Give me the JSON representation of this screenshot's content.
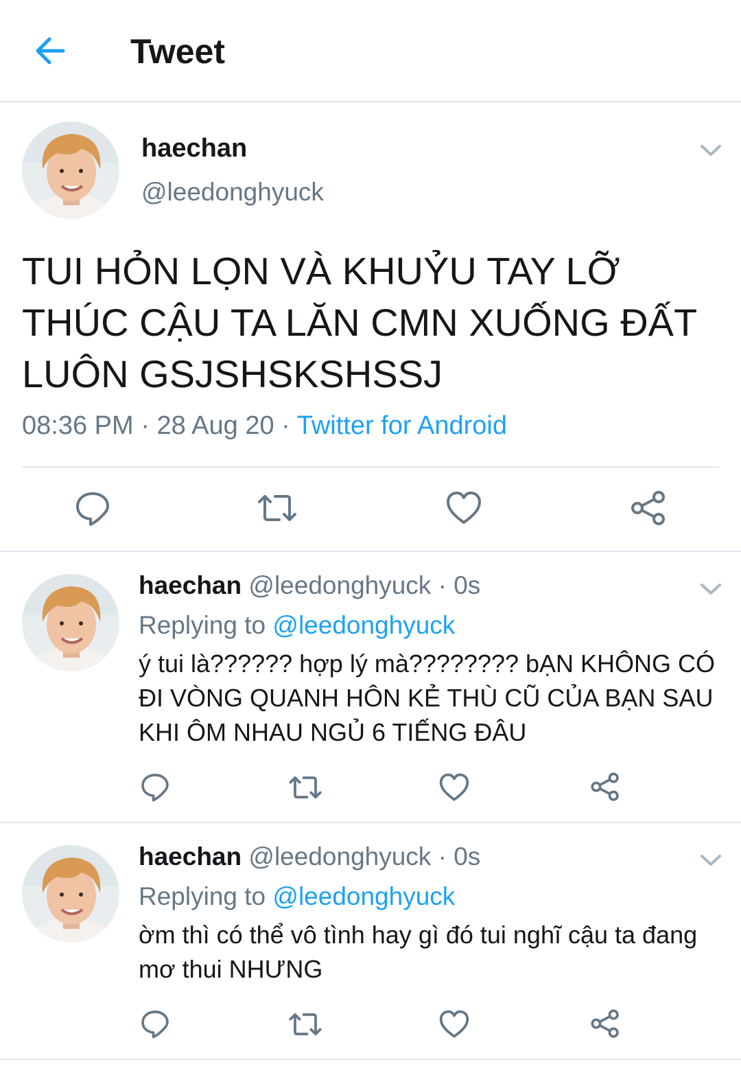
{
  "header": {
    "title": "Tweet",
    "back_icon": "arrow-left-icon",
    "accent": "#1da1f2"
  },
  "main_tweet": {
    "name": "haechan",
    "handle": "@leedonghyuck",
    "text": "TUI HỎN LỌN VÀ KHUỶU TAY LỠ THÚC CẬU TA LĂN CMN XUỐNG ĐẤT LUÔN GSJSHSKSHSSJ",
    "time": "08:36 PM",
    "separator1": " · ",
    "date": "28 Aug 20",
    "separator2": " · ",
    "source": "Twitter for Android"
  },
  "replies": [
    {
      "name": "haechan",
      "handle": "@leedonghyuck",
      "time": "· 0s",
      "replying_label": "Replying to",
      "replying_to": "@leedonghyuck",
      "text": "ý tui là?????? hợp lý mà???????? bẠN KHÔNG CÓ ĐI VÒNG QUANH HÔN KẺ THÙ CŨ CỦA BẠN SAU KHI ÔM NHAU NGỦ 6 TIẾNG ĐÂU"
    },
    {
      "name": "haechan",
      "handle": "@leedonghyuck",
      "time": "· 0s",
      "replying_label": "Replying to",
      "replying_to": "@leedonghyuck",
      "text": "ờm thì có thể vô tình hay gì đó tui nghĩ cậu ta đang mơ thui NHƯNG"
    }
  ],
  "icons": {
    "reply": "comment-icon",
    "retweet": "retweet-icon",
    "like": "heart-icon",
    "share": "share-icon",
    "more": "chevron-down-icon"
  }
}
